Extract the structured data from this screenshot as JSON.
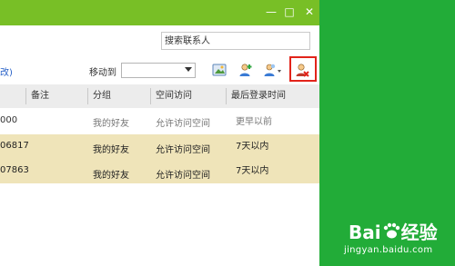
{
  "window": {
    "minimize": "—",
    "maximize": "□",
    "close": "✕"
  },
  "search": {
    "placeholder": "搜索联系人"
  },
  "toolbar": {
    "edit_link": "改)",
    "moveto_label": "移动到",
    "moveto_value": ""
  },
  "table": {
    "headers": [
      "备注",
      "分组",
      "空间访问",
      "最后登录时间"
    ],
    "rows": [
      {
        "id": "000",
        "note": "",
        "group": "我的好友",
        "access": "允许访问空间",
        "last_login": "更早以前",
        "selected": false
      },
      {
        "id": "06817",
        "note": "",
        "group": "我的好友",
        "access": "允许访问空间",
        "last_login": "7天以内",
        "selected": true
      },
      {
        "id": "07863",
        "note": "",
        "group": "我的好友",
        "access": "允许访问空间",
        "last_login": "7天以内",
        "selected": true
      }
    ]
  },
  "colors": {
    "titlebar": "#78bf26",
    "background_green": "#22ac38",
    "selected_row": "#efe4b9",
    "header_bg": "#ececec",
    "highlight_box": "#e2231a"
  },
  "watermark": {
    "brand": "Bai",
    "brand2": "经验",
    "url": "jingyan.baidu.com"
  }
}
